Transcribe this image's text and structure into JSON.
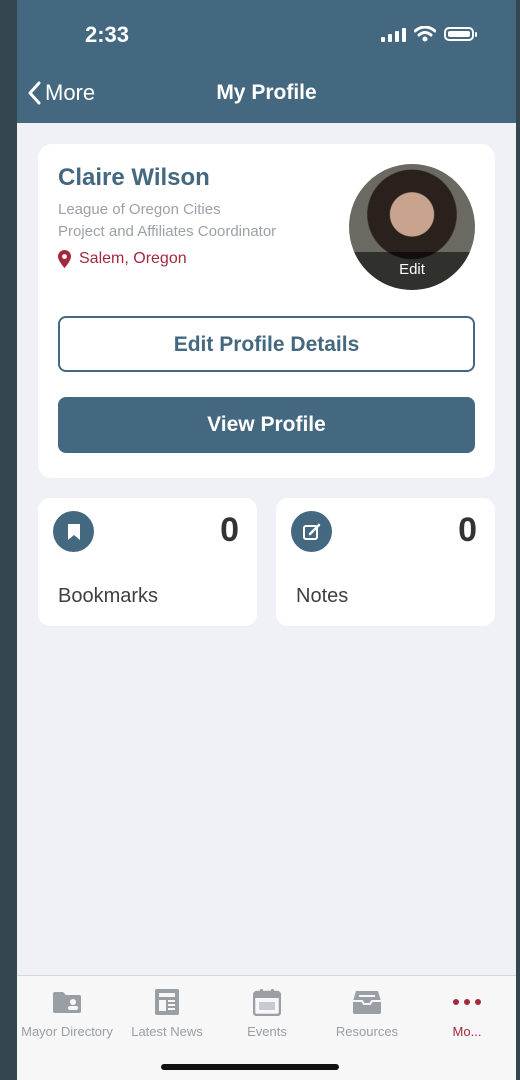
{
  "status_bar": {
    "time": "2:33"
  },
  "nav": {
    "back_label": "More",
    "title": "My Profile"
  },
  "profile": {
    "name": "Claire Wilson",
    "organization": "League of Oregon Cities",
    "role": "Project and Affiliates Coordinator",
    "location": "Salem, Oregon",
    "avatar_edit_label": "Edit",
    "edit_button_label": "Edit Profile Details",
    "view_button_label": "View Profile"
  },
  "tiles": [
    {
      "label": "Bookmarks",
      "count": "0",
      "icon": "bookmark-icon"
    },
    {
      "label": "Notes",
      "count": "0",
      "icon": "edit-note-icon"
    }
  ],
  "tabbar": {
    "items": [
      {
        "label": "Mayor Directory",
        "icon": "folder-id-icon",
        "active": false
      },
      {
        "label": "Latest News",
        "icon": "newspaper-icon",
        "active": false
      },
      {
        "label": "Events",
        "icon": "calendar-icon",
        "active": false
      },
      {
        "label": "Resources",
        "icon": "inbox-tray-icon",
        "active": false
      },
      {
        "label": "Mo...",
        "icon": "more-dots-icon",
        "active": true
      }
    ]
  },
  "colors": {
    "primary": "#44687f",
    "accent": "#a32a3d",
    "background": "#f0f1f6"
  }
}
